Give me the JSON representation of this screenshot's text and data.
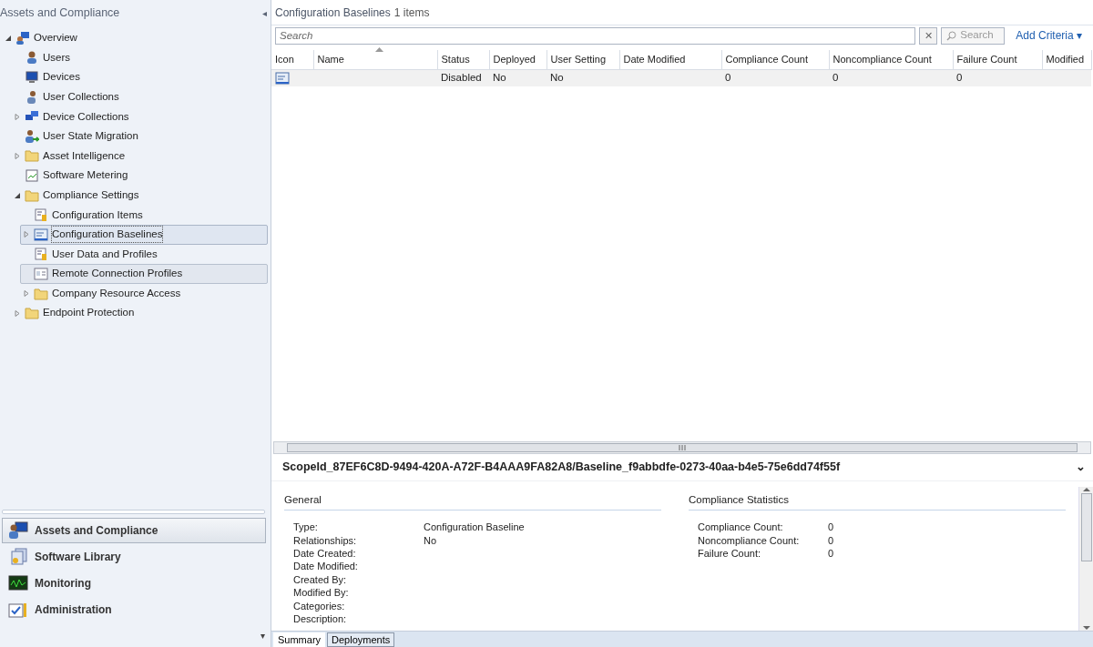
{
  "sidebar": {
    "title": "Assets and Compliance",
    "collapse_glyph": "◂",
    "tree": [
      {
        "label": "Overview",
        "kind": "overview",
        "expanded": true,
        "selected": false,
        "hovered": false,
        "children": [
          {
            "label": "Users",
            "kind": "user",
            "selected": false,
            "hovered": false
          },
          {
            "label": "Devices",
            "kind": "device",
            "selected": false,
            "hovered": false
          },
          {
            "label": "User Collections",
            "kind": "collection",
            "selected": false,
            "hovered": false
          },
          {
            "label": "Device Collections",
            "kind": "device-collection",
            "expanded": false,
            "selected": false,
            "hovered": false
          },
          {
            "label": "User State Migration",
            "kind": "migration",
            "selected": false,
            "hovered": false
          },
          {
            "label": "Asset Intelligence",
            "kind": "folder",
            "expanded": false,
            "selected": false,
            "hovered": false
          },
          {
            "label": "Software Metering",
            "kind": "metering",
            "selected": false,
            "hovered": false
          },
          {
            "label": "Compliance Settings",
            "kind": "folder",
            "expanded": true,
            "selected": false,
            "hovered": false,
            "children": [
              {
                "label": "Configuration Items",
                "kind": "config-item",
                "selected": false,
                "hovered": false
              },
              {
                "label": "Configuration Baselines",
                "kind": "baseline",
                "expanded": false,
                "selected": true,
                "hovered": false
              },
              {
                "label": "User Data and Profiles",
                "kind": "config-item",
                "selected": false,
                "hovered": false
              },
              {
                "label": "Remote Connection Profiles",
                "kind": "profile",
                "selected": false,
                "hovered": true
              },
              {
                "label": "Company Resource Access",
                "kind": "folder",
                "expanded": false,
                "selected": false,
                "hovered": false
              }
            ]
          },
          {
            "label": "Endpoint Protection",
            "kind": "folder",
            "expanded": false,
            "selected": false,
            "hovered": false
          }
        ]
      }
    ],
    "workspaces": [
      {
        "label": "Assets and Compliance",
        "kind": "assets",
        "selected": true
      },
      {
        "label": "Software Library",
        "kind": "library",
        "selected": false
      },
      {
        "label": "Monitoring",
        "kind": "monitoring",
        "selected": false
      },
      {
        "label": "Administration",
        "kind": "administration",
        "selected": false
      }
    ],
    "more_glyph": "▾"
  },
  "list": {
    "title": "Configuration Baselines",
    "count": "1 items",
    "search": {
      "placeholder": "Search",
      "clear_glyph": "✕",
      "button": "Search",
      "add_criteria": "Add Criteria ▾"
    },
    "columns": [
      {
        "label": "Icon",
        "sorted": false
      },
      {
        "label": "Name",
        "sorted": true
      },
      {
        "label": "Status",
        "sorted": false
      },
      {
        "label": "Deployed",
        "sorted": false
      },
      {
        "label": "User Setting",
        "sorted": false
      },
      {
        "label": "Date Modified",
        "sorted": false
      },
      {
        "label": "Compliance Count",
        "sorted": false
      },
      {
        "label": "Noncompliance Count",
        "sorted": false
      },
      {
        "label": "Failure Count",
        "sorted": false
      },
      {
        "label": "Modified",
        "sorted": false
      }
    ],
    "rows": [
      {
        "selected": false,
        "cells": [
          null,
          null,
          "Disabled",
          "No",
          "No",
          null,
          "0",
          "0",
          "0",
          null
        ]
      }
    ]
  },
  "details": {
    "heading": "ScopeId_87EF6C8D-9494-420A-A72F-B4AAA9FA82A8/Baseline_f9abbdfe-0273-40aa-b4e5-75e6dd74f55f",
    "expand_glyph": "⌄",
    "sections": [
      {
        "title": "General",
        "fields": [
          {
            "label": "Type:",
            "value": "Configuration Baseline"
          },
          {
            "label": "Relationships:",
            "value": "No"
          },
          {
            "label": "Date Created:"
          },
          {
            "label": "Date Modified:"
          },
          {
            "label": "Created By:"
          },
          {
            "label": "Modified By:"
          },
          {
            "label": "Categories:"
          },
          {
            "label": "Description:"
          }
        ]
      },
      {
        "title": "Compliance Statistics",
        "fields": [
          {
            "label": "Compliance Count:",
            "value": "0"
          },
          {
            "label": "Noncompliance Count:",
            "value": "0"
          },
          {
            "label": "Failure Count:",
            "value": "0"
          }
        ]
      }
    ],
    "tabs": [
      {
        "label": "Summary",
        "selected": true
      },
      {
        "label": "Deployments",
        "selected": false
      }
    ]
  }
}
